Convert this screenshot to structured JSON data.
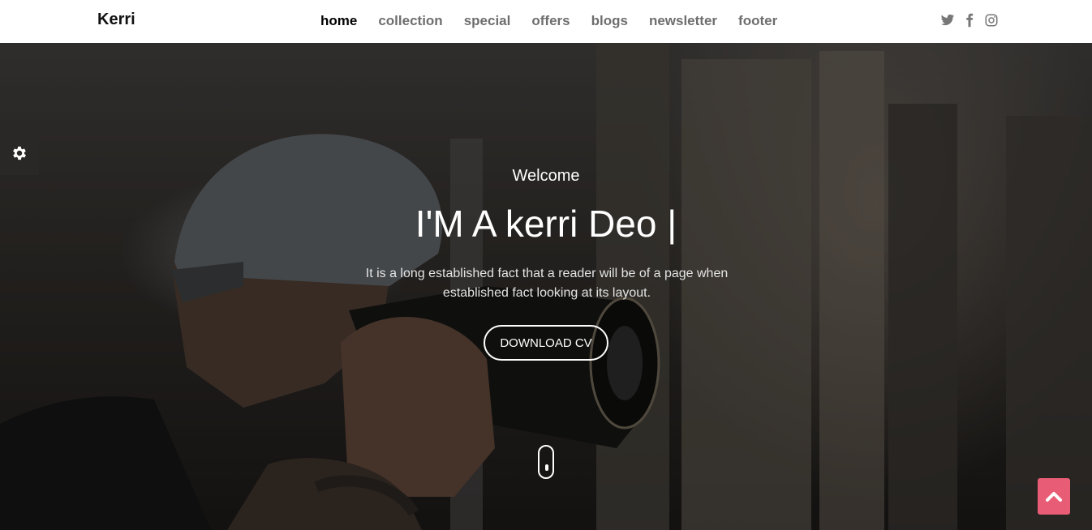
{
  "brand": "Kerri",
  "nav": [
    {
      "label": "home",
      "active": true
    },
    {
      "label": "collection",
      "active": false
    },
    {
      "label": "special",
      "active": false
    },
    {
      "label": "offers",
      "active": false
    },
    {
      "label": "blogs",
      "active": false
    },
    {
      "label": "newsletter",
      "active": false
    },
    {
      "label": "footer",
      "active": false
    }
  ],
  "social_icons": [
    "twitter-icon",
    "facebook-icon",
    "instagram-icon"
  ],
  "hero": {
    "welcome": "Welcome",
    "headline": "I'M A kerri Deo |",
    "description": "It is a long established fact that a reader will be of a page when established fact looking at its layout.",
    "cta_label": "DOWNLOAD CV"
  },
  "colors": {
    "accent": "#e85d75",
    "nav_active": "#000000",
    "nav_inactive": "#6e6e6e",
    "settings_tab": "#2a2827"
  }
}
